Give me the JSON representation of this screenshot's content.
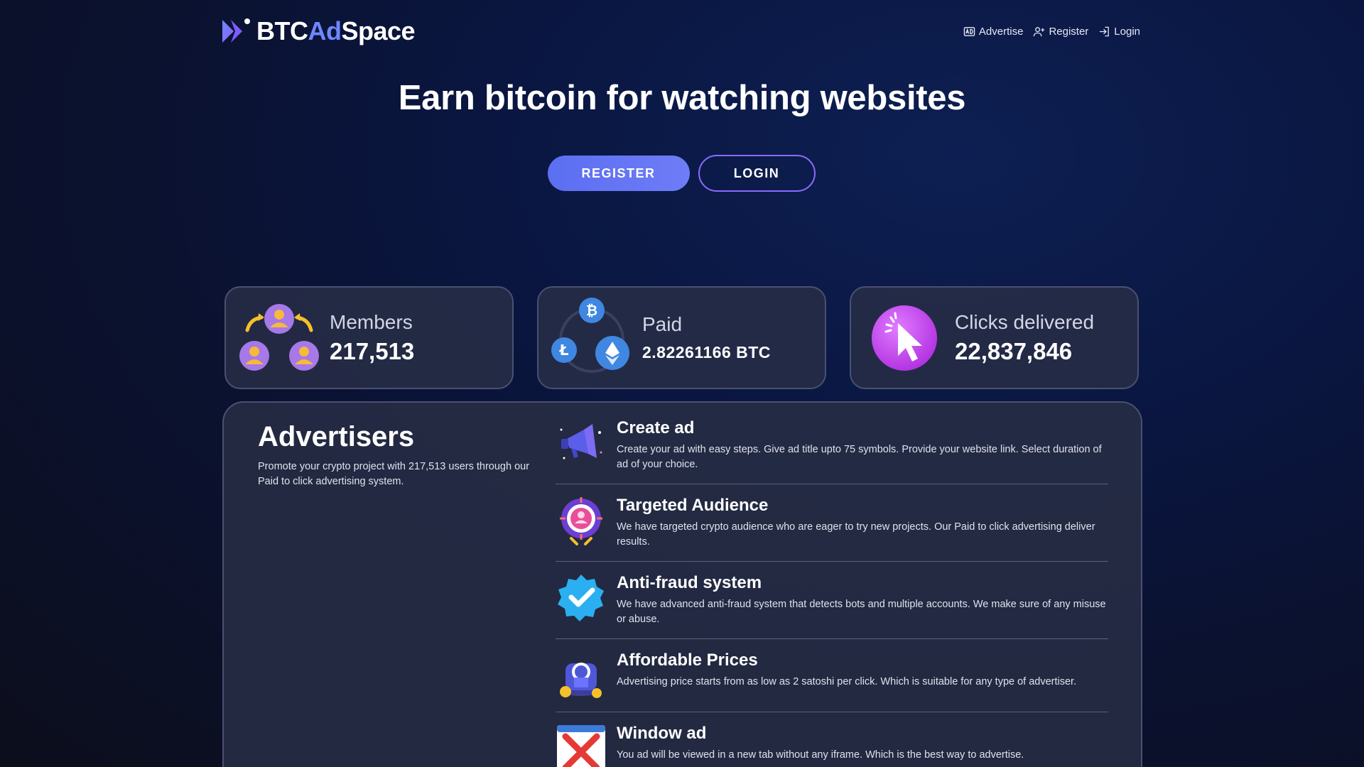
{
  "header": {
    "logo_text_part1": "BTC",
    "logo_text_part2": "Ad",
    "logo_text_part3": "Space",
    "nav": [
      {
        "label": "Advertise",
        "icon": "ad-icon"
      },
      {
        "label": "Register",
        "icon": "user-plus-icon"
      },
      {
        "label": "Login",
        "icon": "login-icon"
      }
    ]
  },
  "hero": {
    "title": "Earn bitcoin for watching websites",
    "register_label": "REGISTER",
    "login_label": "LOGIN"
  },
  "stats": [
    {
      "label": "Members",
      "value": "217,513",
      "icon": "members-icon"
    },
    {
      "label": "Paid",
      "value": "2.82261166 BTC",
      "icon": "crypto-coins-icon"
    },
    {
      "label": "Clicks delivered",
      "value": "22,837,846",
      "icon": "click-cursor-icon"
    }
  ],
  "advertisers": {
    "title": "Advertisers",
    "description": "Promote your crypto project with 217,513 users through our Paid to click advertising system.",
    "features": [
      {
        "title": "Create ad",
        "description": "Create your ad with easy steps. Give ad title upto 75 symbols. Provide your website link. Select duration of ad of your choice.",
        "icon": "megaphone-icon"
      },
      {
        "title": "Targeted Audience",
        "description": "We have targeted crypto audience who are eager to try new projects. Our Paid to click advertising deliver results.",
        "icon": "target-audience-icon"
      },
      {
        "title": "Anti-fraud system",
        "description": "We have advanced anti-fraud system that detects bots and multiple accounts. We make sure of any misuse or abuse.",
        "icon": "verified-badge-icon"
      },
      {
        "title": "Affordable Prices",
        "description": "Advertising price starts from as low as 2 satoshi per click. Which is suitable for any type of advertiser.",
        "icon": "coin-stack-icon"
      },
      {
        "title": "Window ad",
        "description": "You ad will be viewed in a new tab without any iframe. Which is the best way to advertise.",
        "icon": "window-close-icon"
      }
    ]
  },
  "colors": {
    "accent": "#6f86ff",
    "button_gradient_start": "#5b6ff2",
    "login_border": "#8a6bff",
    "card_border": "#4a5070"
  }
}
